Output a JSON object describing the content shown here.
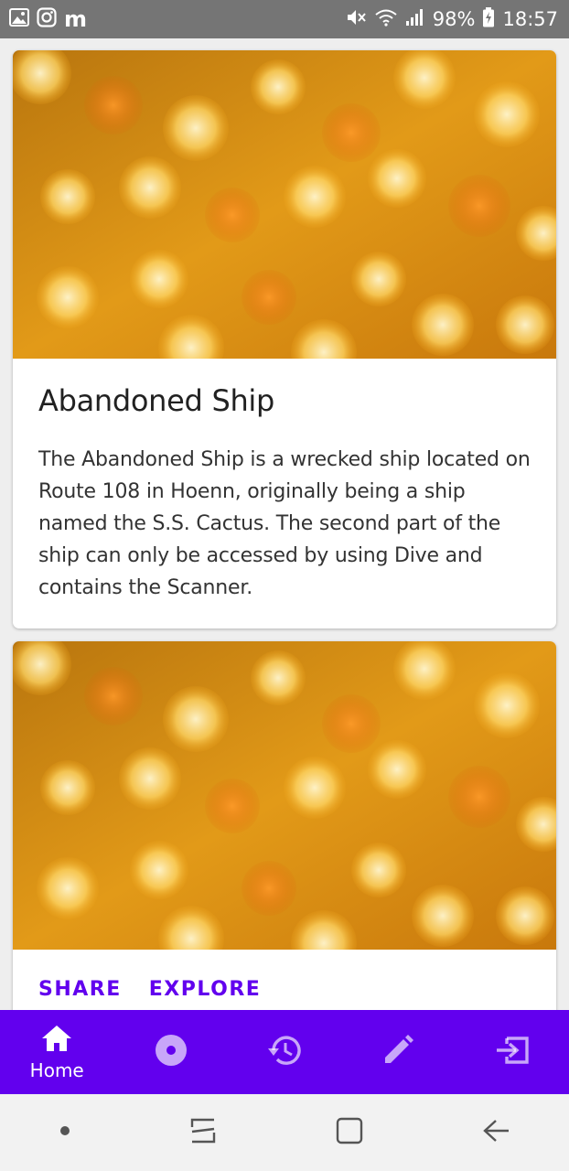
{
  "status_bar": {
    "left_icons": [
      "gallery-icon",
      "instagram-icon"
    ],
    "app_letter": "m",
    "right_icons": [
      "mute-icon",
      "wifi-icon",
      "signal-icon"
    ],
    "battery": "98%",
    "time": "18:57"
  },
  "cards": [
    {
      "image": "bokeh-image",
      "title": "Abandoned Ship",
      "description": "The Abandoned Ship is a wrecked ship located on Route 108 in Hoenn, originally being a ship named the S.S. Cactus. The second part of the ship can only be accessed by using Dive and contains the Scanner."
    },
    {
      "image": "bokeh-image",
      "actions": [
        "SHARE",
        "EXPLORE"
      ]
    }
  ],
  "bottom_nav": {
    "items": [
      {
        "icon": "home-icon",
        "label": "Home",
        "active": true
      },
      {
        "icon": "disc-icon",
        "label": "",
        "active": false
      },
      {
        "icon": "history-icon",
        "label": "",
        "active": false
      },
      {
        "icon": "edit-icon",
        "label": "",
        "active": false
      },
      {
        "icon": "exit-icon",
        "label": "",
        "active": false
      }
    ]
  },
  "system_nav": [
    "dot-icon",
    "recents-icon",
    "home-square-icon",
    "back-icon"
  ],
  "colors": {
    "accent": "#6200ee",
    "status_bar": "#757575",
    "surface": "#ffffff",
    "background": "#eeeeee"
  }
}
